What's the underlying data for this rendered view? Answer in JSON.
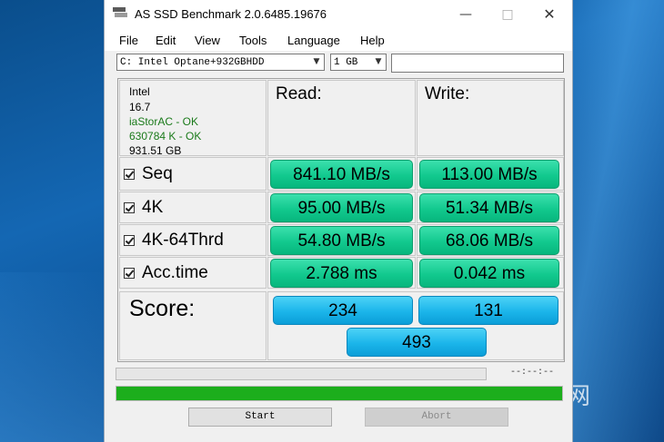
{
  "window": {
    "title": "AS SSD Benchmark 2.0.6485.19676"
  },
  "menu": [
    "File",
    "Edit",
    "View",
    "Tools",
    "Language",
    "Help"
  ],
  "toolbar": {
    "drive": "C: Intel Optane+932GBHDD",
    "size": "1 GB"
  },
  "drive_info": {
    "vendor": "Intel",
    "firmware": "16.7",
    "driver": "iaStorAC - OK",
    "alignment": "630784 K - OK",
    "capacity": "931.51 GB"
  },
  "columns": {
    "read": "Read:",
    "write": "Write:"
  },
  "rows": [
    {
      "label": "Seq",
      "checked": true,
      "read": "841.10 MB/s",
      "write": "113.00 MB/s"
    },
    {
      "label": "4K",
      "checked": true,
      "read": "95.00 MB/s",
      "write": "51.34 MB/s"
    },
    {
      "label": "4K-64Thrd",
      "checked": true,
      "read": "54.80 MB/s",
      "write": "68.06 MB/s"
    },
    {
      "label": "Acc.time",
      "checked": true,
      "read": "2.788 ms",
      "write": "0.042 ms"
    }
  ],
  "score": {
    "label": "Score:",
    "read": "234",
    "write": "131",
    "total": "493"
  },
  "status": {
    "time": "--:--:--",
    "progress_top": 0,
    "progress_bottom": 1.0
  },
  "buttons": {
    "start": "Start",
    "abort": "Abort"
  },
  "watermark": "泡泡网",
  "colors": {
    "result": "#12c98e",
    "score": "#1bb5ea",
    "progress": "#1cae1c",
    "ok_text": "#1a7a1a"
  }
}
